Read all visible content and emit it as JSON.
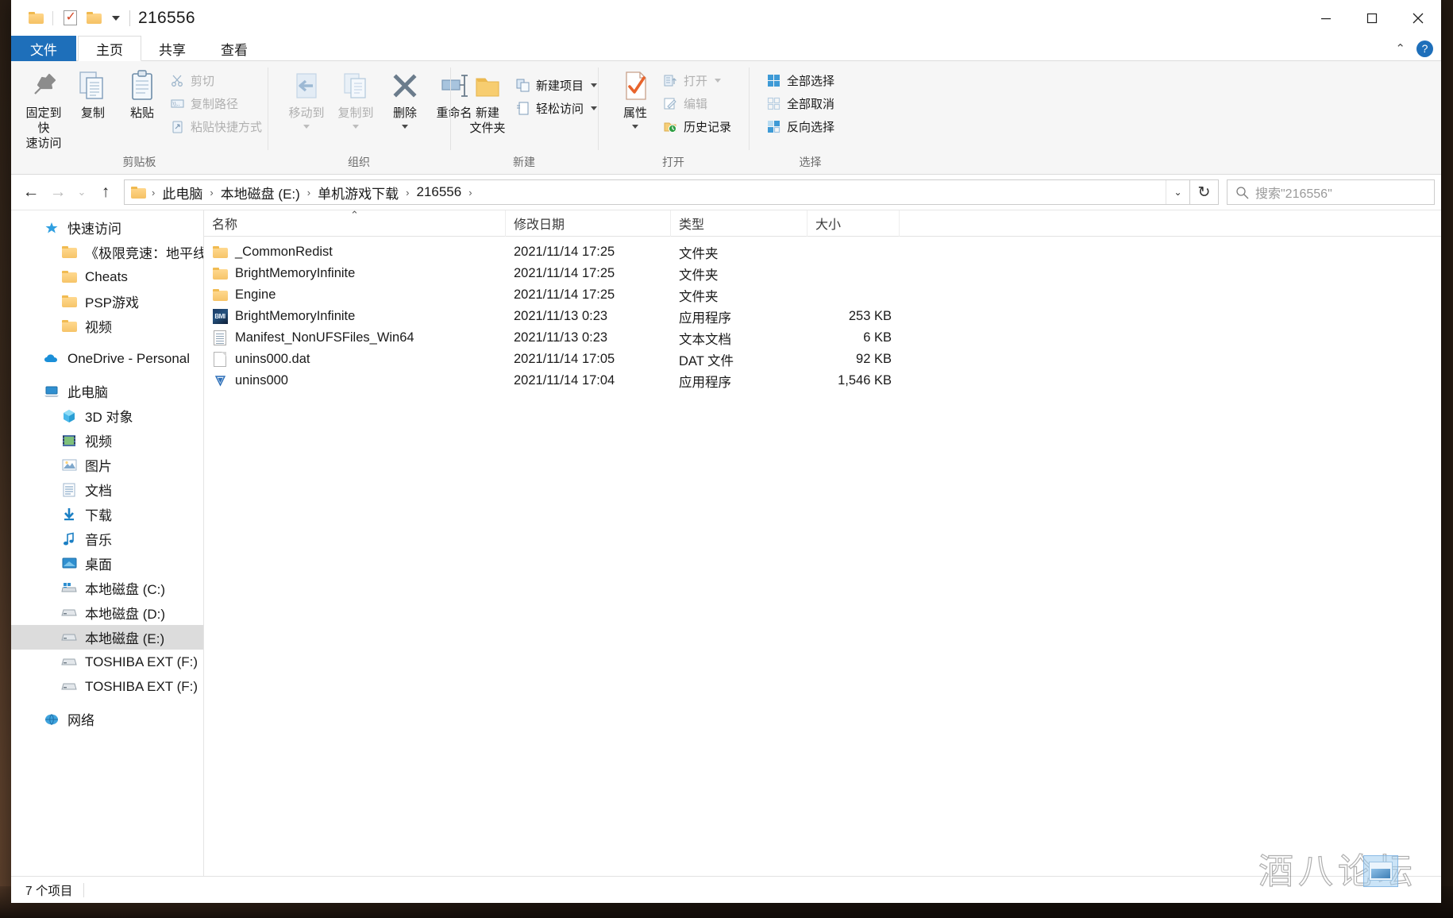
{
  "window": {
    "title": "216556",
    "quick_access_icons": [
      "folder-icon",
      "checkmark-document-icon",
      "folder-icon"
    ],
    "controls": {
      "minimize": "minimize-icon",
      "maximize": "maximize-icon",
      "close": "close-icon"
    }
  },
  "tabs": [
    {
      "label": "文件",
      "name": "tab-file"
    },
    {
      "label": "主页",
      "name": "tab-home"
    },
    {
      "label": "共享",
      "name": "tab-share"
    },
    {
      "label": "查看",
      "name": "tab-view"
    }
  ],
  "ribbon": {
    "groups": [
      {
        "label": "剪贴板",
        "big": [
          {
            "label": "固定到快\n速访问",
            "icon": "pin-icon"
          },
          {
            "label": "复制",
            "icon": "copy-icon"
          },
          {
            "label": "粘贴",
            "icon": "paste-icon"
          }
        ],
        "small": [
          {
            "label": "剪切",
            "icon": "scissors-icon",
            "disabled": true
          },
          {
            "label": "复制路径",
            "icon": "copy-path-icon",
            "disabled": true
          },
          {
            "label": "粘贴快捷方式",
            "icon": "paste-shortcut-icon",
            "disabled": true
          }
        ]
      },
      {
        "label": "组织",
        "big": [
          {
            "label": "移动到",
            "icon": "move-to-icon",
            "disabled": true,
            "dropdown": true
          },
          {
            "label": "复制到",
            "icon": "copy-to-icon",
            "disabled": true,
            "dropdown": true
          },
          {
            "label": "删除",
            "icon": "delete-icon",
            "dropdown": true
          },
          {
            "label": "重命名",
            "icon": "rename-icon"
          }
        ]
      },
      {
        "label": "新建",
        "big": [
          {
            "label": "新建\n文件夹",
            "icon": "new-folder-icon"
          }
        ],
        "small": [
          {
            "label": "新建项目",
            "icon": "new-item-icon",
            "dropdown": true
          },
          {
            "label": "轻松访问",
            "icon": "easy-access-icon",
            "dropdown": true
          }
        ]
      },
      {
        "label": "打开",
        "big": [
          {
            "label": "属性",
            "icon": "properties-icon",
            "dropdown": true
          }
        ],
        "small": [
          {
            "label": "打开",
            "icon": "open-icon",
            "disabled": true,
            "dropdown": true
          },
          {
            "label": "编辑",
            "icon": "edit-icon",
            "disabled": true
          },
          {
            "label": "历史记录",
            "icon": "history-icon"
          }
        ]
      },
      {
        "label": "选择",
        "small": [
          {
            "label": "全部选择",
            "icon": "select-all-icon"
          },
          {
            "label": "全部取消",
            "icon": "select-none-icon"
          },
          {
            "label": "反向选择",
            "icon": "invert-selection-icon"
          }
        ]
      }
    ]
  },
  "address": {
    "back": "back-arrow-icon",
    "forward": "forward-arrow-icon",
    "recent": "recent-dropdown-icon",
    "up": "up-arrow-icon",
    "crumbs": [
      "此电脑",
      "本地磁盘 (E:)",
      "单机游戏下载",
      "216556"
    ],
    "dropdown": "address-dropdown-icon",
    "refresh": "refresh-icon"
  },
  "search": {
    "placeholder": "搜索\"216556\"",
    "icon": "search-icon"
  },
  "sidebar": {
    "quick_access": {
      "label": "快速访问",
      "icon": "star-icon"
    },
    "quick_items": [
      {
        "label": "《极限竞速：地平线",
        "icon": "folder-icon"
      },
      {
        "label": "Cheats",
        "icon": "folder-icon"
      },
      {
        "label": "PSP游戏",
        "icon": "folder-icon"
      },
      {
        "label": "视频",
        "icon": "folder-icon"
      }
    ],
    "onedrive": {
      "label": "OneDrive - Personal",
      "icon": "cloud-icon"
    },
    "this_pc": {
      "label": "此电脑",
      "icon": "computer-icon"
    },
    "pc_items": [
      {
        "label": "3D 对象",
        "icon": "3d-object-icon"
      },
      {
        "label": "视频",
        "icon": "videos-icon"
      },
      {
        "label": "图片",
        "icon": "pictures-icon"
      },
      {
        "label": "文档",
        "icon": "documents-icon"
      },
      {
        "label": "下载",
        "icon": "downloads-icon"
      },
      {
        "label": "音乐",
        "icon": "music-icon"
      },
      {
        "label": "桌面",
        "icon": "desktop-icon"
      },
      {
        "label": "本地磁盘 (C:)",
        "icon": "system-drive-icon"
      },
      {
        "label": "本地磁盘 (D:)",
        "icon": "drive-icon"
      },
      {
        "label": "本地磁盘 (E:)",
        "icon": "drive-icon",
        "selected": true
      },
      {
        "label": "TOSHIBA EXT (F:)",
        "icon": "drive-icon"
      },
      {
        "label": "TOSHIBA EXT (F:)",
        "icon": "drive-icon"
      }
    ],
    "network": {
      "label": "网络",
      "icon": "network-icon"
    }
  },
  "filelist": {
    "columns": [
      "名称",
      "修改日期",
      "类型",
      "大小"
    ],
    "sort": {
      "column": "名称",
      "direction": "asc",
      "glyph": "⌃"
    },
    "rows": [
      {
        "name": "_CommonRedist",
        "date": "2021/11/14 17:25",
        "type": "文件夹",
        "size": "",
        "icon": "folder-icon"
      },
      {
        "name": "BrightMemoryInfinite",
        "date": "2021/11/14 17:25",
        "type": "文件夹",
        "size": "",
        "icon": "folder-icon"
      },
      {
        "name": "Engine",
        "date": "2021/11/14 17:25",
        "type": "文件夹",
        "size": "",
        "icon": "folder-icon"
      },
      {
        "name": "BrightMemoryInfinite",
        "date": "2021/11/13 0:23",
        "type": "应用程序",
        "size": "253 KB",
        "icon": "exe-bmi-icon"
      },
      {
        "name": "Manifest_NonUFSFiles_Win64",
        "date": "2021/11/13 0:23",
        "type": "文本文档",
        "size": "6 KB",
        "icon": "text-file-icon"
      },
      {
        "name": "unins000.dat",
        "date": "2021/11/14 17:05",
        "type": "DAT 文件",
        "size": "92 KB",
        "icon": "dat-file-icon"
      },
      {
        "name": "unins000",
        "date": "2021/11/14 17:04",
        "type": "应用程序",
        "size": "1,546 KB",
        "icon": "uninstaller-icon"
      }
    ]
  },
  "status": {
    "item_count": "7 个项目"
  },
  "watermark": {
    "text": "酒八论坛"
  },
  "colors": {
    "accent": "#1e6fba",
    "folder": "#f6c468",
    "selection": "#dcdcdc",
    "hover": "#eaf3fc"
  }
}
